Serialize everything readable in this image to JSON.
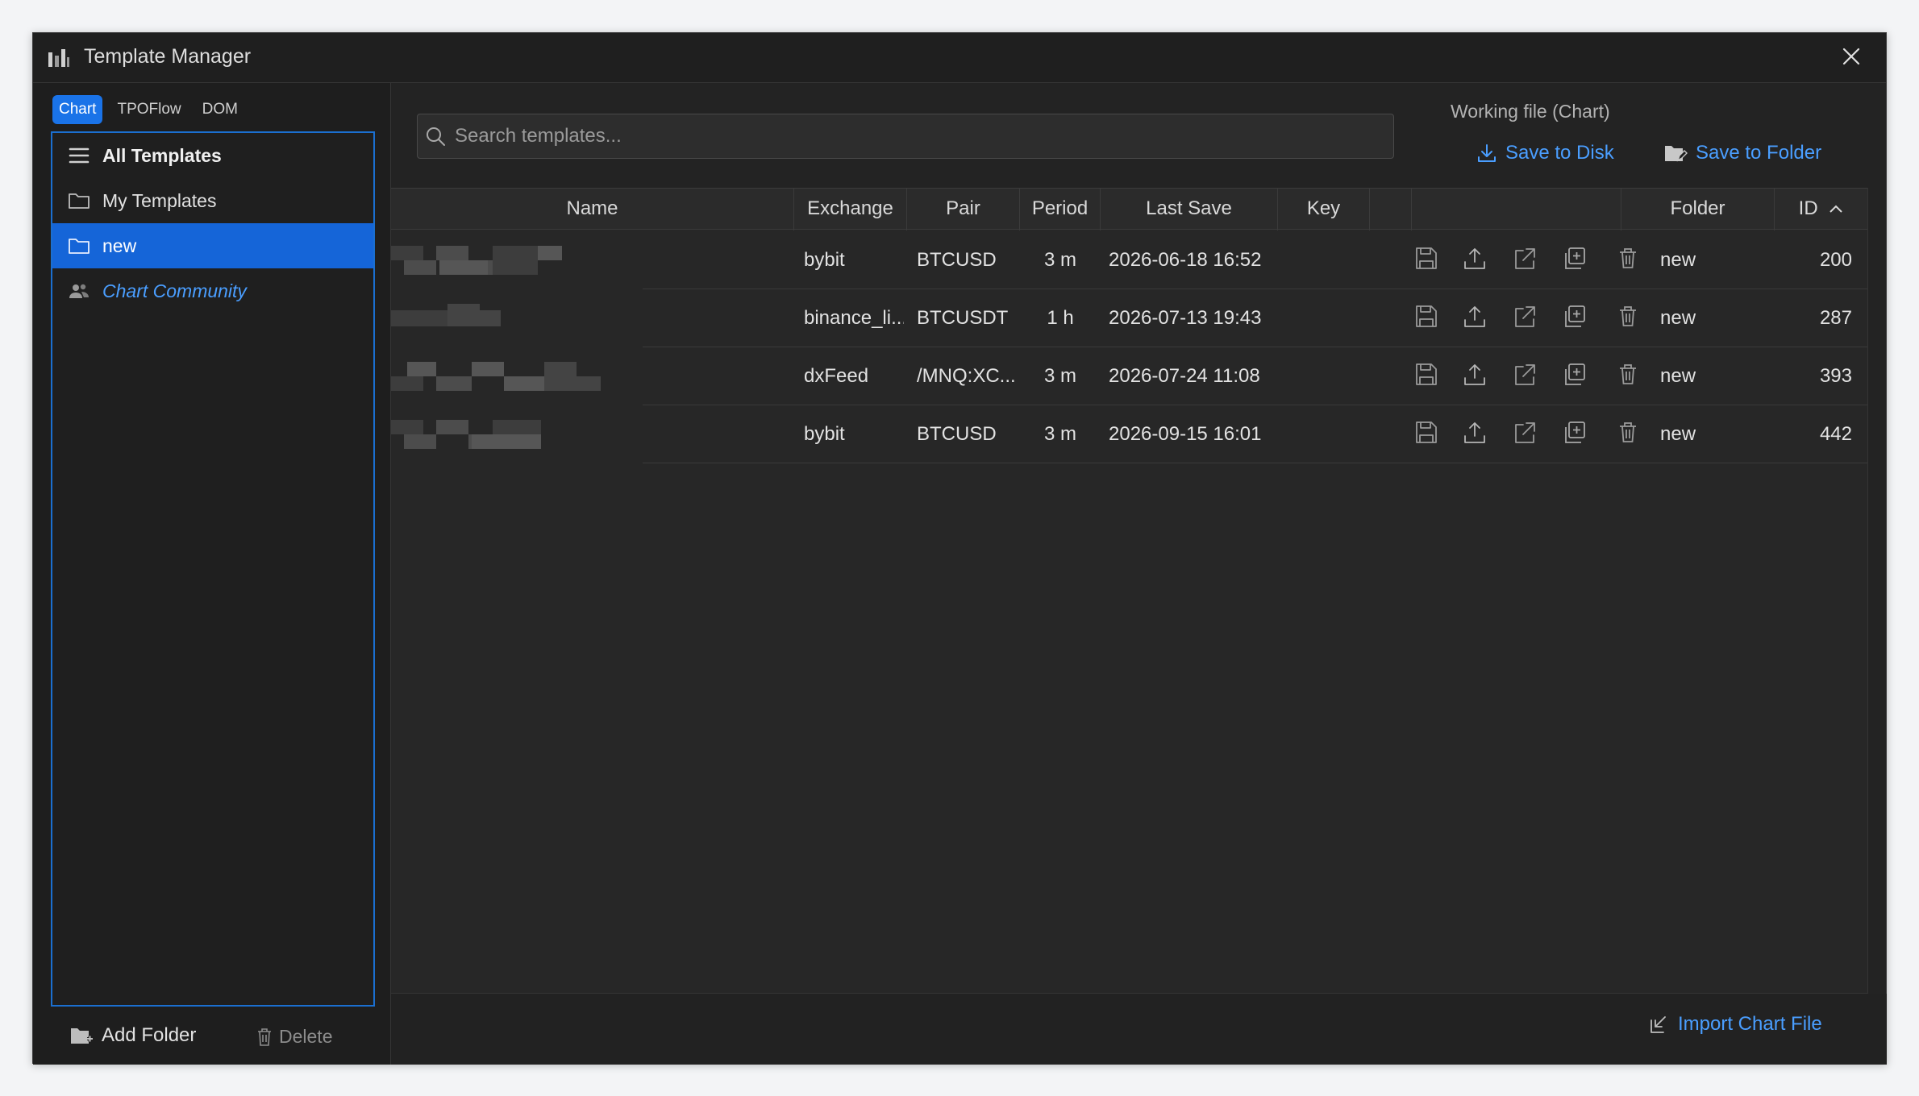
{
  "window": {
    "title": "Template Manager"
  },
  "tabs": [
    {
      "label": "Chart",
      "active": true
    },
    {
      "label": "TPOFlow",
      "active": false
    },
    {
      "label": "DOM",
      "active": false
    }
  ],
  "sidebar": {
    "items": [
      {
        "label": "All Templates",
        "icon": "list-icon"
      },
      {
        "label": "My Templates",
        "icon": "folder-icon"
      },
      {
        "label": "new",
        "icon": "folder-icon",
        "selected": true
      },
      {
        "label": "Chart Community",
        "icon": "users-icon"
      }
    ],
    "add_folder": "Add Folder",
    "delete": "Delete"
  },
  "search": {
    "placeholder": "Search templates..."
  },
  "working_file": {
    "label": "Working file (Chart)",
    "save_disk": "Save to Disk",
    "save_folder": "Save to Folder"
  },
  "table": {
    "headers": {
      "name": "Name",
      "exchange": "Exchange",
      "pair": "Pair",
      "period": "Period",
      "last_save": "Last Save",
      "key": "Key",
      "folder": "Folder",
      "id": "ID"
    },
    "sort": {
      "column": "ID",
      "direction": "ascending"
    },
    "rows": [
      {
        "exchange": "bybit",
        "pair": "BTCUSD",
        "period": "3 m",
        "last_save": "2026-06-18 16:52",
        "folder": "new",
        "id": "200"
      },
      {
        "exchange": "binance_li...",
        "pair": "BTCUSDT",
        "period": "1 h",
        "last_save": "2026-07-13 19:43",
        "folder": "new",
        "id": "287"
      },
      {
        "exchange": "dxFeed",
        "pair": "/MNQ:XC...",
        "period": "3 m",
        "last_save": "2026-07-24 11:08",
        "folder": "new",
        "id": "393"
      },
      {
        "exchange": "bybit",
        "pair": "BTCUSD",
        "period": "3 m",
        "last_save": "2026-09-15 16:01",
        "folder": "new",
        "id": "442"
      }
    ]
  },
  "footer": {
    "import": "Import Chart File"
  },
  "colors": {
    "accent": "#1a73e8",
    "link": "#4a9eff",
    "selected": "#1565d8"
  }
}
